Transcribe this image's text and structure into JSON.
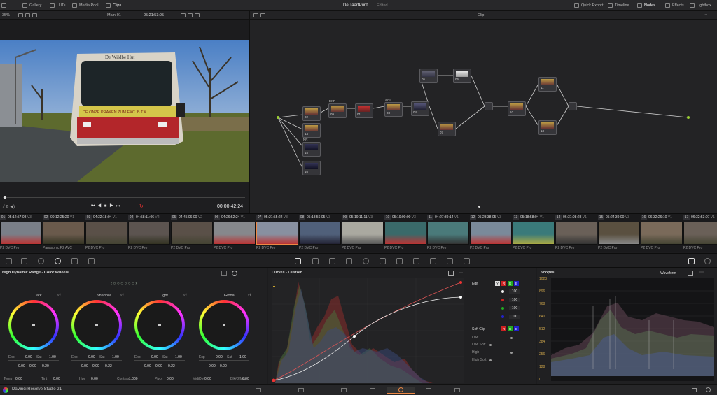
{
  "topbar": {
    "gallery": "Gallery",
    "luts": "LUTs",
    "media_pool": "Media Pool",
    "clips": "Clips",
    "project": "De TaartPunt",
    "status": "Edited",
    "quick_export": "Quick Export",
    "timeline": "Timeline",
    "nodes": "Nodes",
    "effects": "Effects",
    "lightbox": "Lightbox"
  },
  "subbar": {
    "zoom": "35%",
    "timeline_name": "Main-01",
    "timecode": "05:21:53:05",
    "node_mode": "Clip"
  },
  "viewer": {
    "timecode": "00:00:42:24",
    "bus_text": "De Wildbe Hut",
    "bus_text2": "DE ONZE PRAKEN ZUM EXC. B.T.K."
  },
  "nodes": [
    {
      "id": "02",
      "label": "02"
    },
    {
      "id": "09",
      "label": "09",
      "name": "EXP"
    },
    {
      "id": "01",
      "label": "01"
    },
    {
      "id": "03",
      "label": "03",
      "name": "SAT"
    },
    {
      "id": "04",
      "label": "04"
    },
    {
      "id": "05",
      "label": "05"
    },
    {
      "id": "06",
      "label": "06"
    },
    {
      "id": "07",
      "label": "07"
    },
    {
      "id": "10",
      "label": "10"
    },
    {
      "id": "11",
      "label": "11"
    },
    {
      "id": "13",
      "label": "13"
    },
    {
      "id": "14",
      "label": "14"
    },
    {
      "id": "15",
      "label": "15",
      "name": "NR"
    },
    {
      "id": "16",
      "label": "16"
    }
  ],
  "clips": [
    {
      "num": "01",
      "tc": "05:12:57:08",
      "track": "V3",
      "cap": "P2 DVC Pro"
    },
    {
      "num": "02",
      "tc": "00:12:25:20",
      "track": "V1",
      "cap": "Panasonic P2 AVC"
    },
    {
      "num": "03",
      "tc": "04:32:18:04",
      "track": "V1",
      "cap": "P2 DVC Pro"
    },
    {
      "num": "04",
      "tc": "04:58:11:06",
      "track": "V2",
      "cap": "P2 DVC Pro"
    },
    {
      "num": "05",
      "tc": "04:45:06:00",
      "track": "V2",
      "cap": "P2 DVC Pro"
    },
    {
      "num": "06",
      "tc": "04:26:52:24",
      "track": "V1",
      "cap": "P2 DVC Pro"
    },
    {
      "num": "07",
      "tc": "05:21:55:22",
      "track": "V3",
      "cap": "P2 DVC Pro"
    },
    {
      "num": "08",
      "tc": "05:18:56:05",
      "track": "V3",
      "cap": "P2 DVC Pro"
    },
    {
      "num": "09",
      "tc": "05:19:11:11",
      "track": "V3",
      "cap": "P2 DVC Pro"
    },
    {
      "num": "10",
      "tc": "05:19:00:00",
      "track": "V3",
      "cap": "P2 DVC Pro"
    },
    {
      "num": "11",
      "tc": "04:27:39:14",
      "track": "V1",
      "cap": "P2 DVC Pro"
    },
    {
      "num": "12",
      "tc": "05:23:38:05",
      "track": "V3",
      "cap": "P2 DVC Pro"
    },
    {
      "num": "13",
      "tc": "05:18:58:04",
      "track": "V1",
      "cap": "P2 DVC Pro"
    },
    {
      "num": "14",
      "tc": "06:31:08:23",
      "track": "V1",
      "cap": "P2 DVC Pro"
    },
    {
      "num": "15",
      "tc": "05:24:39:00",
      "track": "V3",
      "cap": "P2 DVC Pro"
    },
    {
      "num": "16",
      "tc": "06:32:26:10",
      "track": "V1",
      "cap": "P2 DVC Pro"
    },
    {
      "num": "17",
      "tc": "06:32:53:07",
      "track": "V1",
      "cap": "P2 DVC Pro"
    }
  ],
  "wheels_panel": {
    "title": "High Dynamic Range - Color Wheels",
    "wheels": [
      {
        "name": "Dark",
        "exp": "0.00",
        "sat": "1.00",
        "x": "0.00",
        "y": "0.00",
        "z": "0.20",
        "top": "+1.00"
      },
      {
        "name": "Shadow",
        "exp": "0.00",
        "sat": "1.00",
        "x": "0.00",
        "y": "0.00",
        "z": "0.22",
        "top": "+1.00"
      },
      {
        "name": "Light",
        "exp": "0.00",
        "sat": "1.00",
        "x": "0.00",
        "y": "0.00",
        "z": "0.22",
        "top": "+1.00"
      },
      {
        "name": "Global",
        "exp": "0.00",
        "sat": "1.00",
        "x": "0.00",
        "y": "0.00",
        "z": ""
      }
    ],
    "exp_label": "Exp",
    "sat_label": "Sat",
    "bottom": [
      {
        "label": "Temp",
        "val": "0.00"
      },
      {
        "label": "Tint",
        "val": "0.00"
      },
      {
        "label": "Hue",
        "val": "0.00"
      },
      {
        "label": "Contrast",
        "val": "1.000"
      },
      {
        "label": "Pivot",
        "val": "0.00"
      },
      {
        "label": "MidiDet",
        "val": "0.00"
      },
      {
        "label": "Blk/Offset",
        "val": "0.00"
      }
    ]
  },
  "curves": {
    "title": "Curves - Custom"
  },
  "edit": {
    "title": "Edit",
    "rows": [
      "100",
      "100",
      "100",
      "100"
    ],
    "softclip": "Soft Clip",
    "low": "Low",
    "low_soft": "Low Soft",
    "high": "High",
    "high_soft": "High Soft",
    "y": "Y",
    "r": "R",
    "g": "G",
    "b": "B"
  },
  "scopes": {
    "title": "Scopes",
    "mode": "Waveform",
    "ticks": [
      "1023",
      "896",
      "768",
      "640",
      "512",
      "384",
      "256",
      "128",
      "0"
    ]
  },
  "app": {
    "name": "DaVinci Resolve Studio 21"
  }
}
